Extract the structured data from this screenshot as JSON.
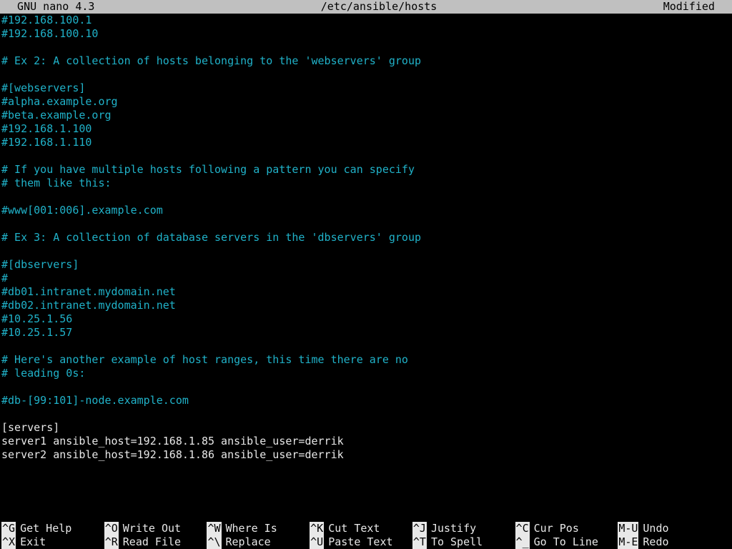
{
  "titlebar": {
    "app": "  GNU nano 4.3",
    "file": "/etc/ansible/hosts",
    "status": "Modified  "
  },
  "lines": [
    {
      "cls": "comment",
      "text": "#192.168.100.1"
    },
    {
      "cls": "comment",
      "text": "#192.168.100.10"
    },
    {
      "cls": "comment",
      "text": ""
    },
    {
      "cls": "comment",
      "text": "# Ex 2: A collection of hosts belonging to the 'webservers' group"
    },
    {
      "cls": "comment",
      "text": ""
    },
    {
      "cls": "comment",
      "text": "#[webservers]"
    },
    {
      "cls": "comment",
      "text": "#alpha.example.org"
    },
    {
      "cls": "comment",
      "text": "#beta.example.org"
    },
    {
      "cls": "comment",
      "text": "#192.168.1.100"
    },
    {
      "cls": "comment",
      "text": "#192.168.1.110"
    },
    {
      "cls": "comment",
      "text": ""
    },
    {
      "cls": "comment",
      "text": "# If you have multiple hosts following a pattern you can specify"
    },
    {
      "cls": "comment",
      "text": "# them like this:"
    },
    {
      "cls": "comment",
      "text": ""
    },
    {
      "cls": "comment",
      "text": "#www[001:006].example.com"
    },
    {
      "cls": "comment",
      "text": ""
    },
    {
      "cls": "comment",
      "text": "# Ex 3: A collection of database servers in the 'dbservers' group"
    },
    {
      "cls": "comment",
      "text": ""
    },
    {
      "cls": "comment",
      "text": "#[dbservers]"
    },
    {
      "cls": "comment",
      "text": "#"
    },
    {
      "cls": "comment",
      "text": "#db01.intranet.mydomain.net"
    },
    {
      "cls": "comment",
      "text": "#db02.intranet.mydomain.net"
    },
    {
      "cls": "comment",
      "text": "#10.25.1.56"
    },
    {
      "cls": "comment",
      "text": "#10.25.1.57"
    },
    {
      "cls": "comment",
      "text": ""
    },
    {
      "cls": "comment",
      "text": "# Here's another example of host ranges, this time there are no"
    },
    {
      "cls": "comment",
      "text": "# leading 0s:"
    },
    {
      "cls": "comment",
      "text": ""
    },
    {
      "cls": "comment",
      "text": "#db-[99:101]-node.example.com"
    },
    {
      "cls": "plain",
      "text": ""
    },
    {
      "cls": "plain",
      "text": "[servers]"
    },
    {
      "cls": "plain",
      "text": "server1 ansible_host=192.168.1.85 ansible_user=derrik"
    },
    {
      "cls": "plain",
      "text": "server2 ansible_host=192.168.1.86 ansible_user=derrik"
    }
  ],
  "help": {
    "row1": [
      {
        "key": "^G",
        "label": "Get Help"
      },
      {
        "key": "^O",
        "label": "Write Out"
      },
      {
        "key": "^W",
        "label": "Where Is"
      },
      {
        "key": "^K",
        "label": "Cut Text"
      },
      {
        "key": "^J",
        "label": "Justify"
      },
      {
        "key": "^C",
        "label": "Cur Pos"
      },
      {
        "key": "M-U",
        "label": "Undo"
      }
    ],
    "row2": [
      {
        "key": "^X",
        "label": "Exit"
      },
      {
        "key": "^R",
        "label": "Read File"
      },
      {
        "key": "^\\",
        "label": "Replace"
      },
      {
        "key": "^U",
        "label": "Paste Text"
      },
      {
        "key": "^T",
        "label": "To Spell"
      },
      {
        "key": "^_",
        "label": "Go To Line"
      },
      {
        "key": "M-E",
        "label": "Redo"
      }
    ]
  }
}
